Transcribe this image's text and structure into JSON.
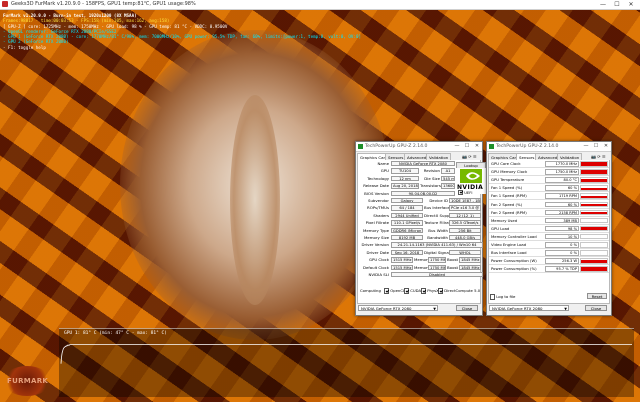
{
  "window": {
    "title": "Geeks3D FurMark v1.20.9.0 - 158FPS, GPU1 temp:81℃, GPU1 usage:98%",
    "controls": [
      "—",
      "☐",
      "✕"
    ]
  },
  "osd": {
    "line0": "FurMark v1.20.9.0 - Burn-in test, 1920x1200 (8X MSAA)",
    "line1": "Frames:98817 - time:00:03:53 - FPS:158 (min:105, max:162, avg:158)",
    "line2": "[ GPU-Z ] core: 1725MHz - mem: 1750MHz - GPU load: 98 % - GPU temp: 81 °C - VDDC: 0.9500V",
    "line3": "- OpenGL renderer: GeForce RTX 2080/PCIe/SSE2",
    "line4": "- GPU 1 (GeForce RTX 2080) - core: 1770MHz/81° C/98%, mem: 7000MHz/10%, GPU power: 95.5% TDP, fan: 60%, limits:[power:1, temp:0, volt:0, OV:0]",
    "line5": "- GPU 2 (GeForce RTX 2080)",
    "line6": "- F1: toggle help"
  },
  "graph": {
    "label": "GPU 1: 81° C (min: 47° C - max: 81° C)",
    "series": [
      47,
      58,
      66,
      70,
      73,
      75,
      76,
      77,
      78,
      78,
      79,
      79,
      80,
      80,
      80,
      80,
      81,
      81,
      81,
      81,
      81,
      81,
      81,
      81,
      81,
      81,
      81,
      81,
      81,
      81,
      81,
      81,
      81,
      81,
      81,
      81,
      81,
      81,
      81,
      81,
      81
    ],
    "ymin": 0,
    "ymax": 100
  },
  "logo": {
    "text": "FURMARK"
  },
  "gpuz_card": {
    "title": "TechPowerUp GPU-Z 2.14.0",
    "tabs": [
      "Graphics Card",
      "Sensors",
      "Advanced",
      "Validation"
    ],
    "lookup": "Lookup",
    "uefi": "UEFI",
    "rows": [
      {
        "label": "Name",
        "v1": "NVIDIA GeForce RTX 2080"
      },
      {
        "label": "GPU",
        "v1": "TU104",
        "l2": "Revision",
        "v2": "A1"
      },
      {
        "label": "Technology",
        "v1": "12 nm",
        "l2": "Die Size",
        "v2": "545 mm²"
      },
      {
        "label": "Release Date",
        "v1": "Aug 20, 2018",
        "l2": "Transistors",
        "v2": "13600M"
      },
      {
        "label": "BIOS Version",
        "v1": "90.04.0B.00.D2"
      },
      {
        "label": "Subvendor",
        "v1": "Galaxy",
        "l2": "Device ID",
        "v2": "10DE 1E87 - 1B4C 1302"
      },
      {
        "label": "ROPs/TMUs",
        "v1": "64 / 184",
        "l2": "Bus Interface",
        "v2": "PCIe x16 3.0 @ x16 3.0"
      },
      {
        "label": "Shaders",
        "v1": "2944 Unified",
        "l2": "DirectX Support",
        "v2": "12 (12_1)"
      },
      {
        "label": "Pixel Fillrate",
        "v1": "110.1 GPixel/s",
        "l2": "Texture Fillrate",
        "v2": "326.5 GTexel/s"
      },
      {
        "label": "Memory Type",
        "v1": "GDDR6 (Micron)",
        "l2": "Bus Width",
        "v2": "256 Bit"
      },
      {
        "label": "Memory Size",
        "v1": "8192 MB",
        "l2": "Bandwidth",
        "v2": "448.0 GB/s"
      },
      {
        "label": "Driver Version",
        "v1": "24.21.14.1163 (NVIDIA 411.63) / Win10 64"
      },
      {
        "label": "Driver Date",
        "v1": "Sep 16, 2018",
        "l2": "Digital Signature",
        "v2": "WHQL"
      },
      {
        "label": "GPU Clock",
        "v1": "1515 MHz",
        "l2": "Memory",
        "v2": "1750 MHz",
        "l3": "Boost",
        "v3": "1845 MHz"
      },
      {
        "label": "Default Clock",
        "v1": "1515 MHz",
        "l2": "Memory",
        "v2": "1750 MHz",
        "l3": "Boost",
        "v3": "1845 MHz"
      },
      {
        "label": "NVIDIA SLI",
        "v1": "Disabled"
      }
    ],
    "computing_label": "Computing",
    "computing": [
      "OpenCL",
      "CUDA",
      "PhysX",
      "DirectCompute 5.0"
    ],
    "selected_gpu": "NVIDIA GeForce RTX 2080",
    "close": "Close"
  },
  "gpuz_sensors": {
    "title": "TechPowerUp GPU-Z 2.14.0",
    "tabs": [
      "Graphics Card",
      "Sensors",
      "Advanced",
      "Validation"
    ],
    "rows": [
      {
        "label": "GPU Core Clock",
        "value": "1770.0 MHz",
        "level": 0.95
      },
      {
        "label": "GPU Memory Clock",
        "value": "1750.0 MHz",
        "level": 0.9
      },
      {
        "label": "GPU Temperature",
        "value": "80.0 °C",
        "level": 0.85
      },
      {
        "label": "Fan 1 Speed (%)",
        "value": "60 %",
        "level": 0.6
      },
      {
        "label": "Fan 1 Speed (RPM)",
        "value": "1719 RPM",
        "level": 0.6
      },
      {
        "label": "Fan 2 Speed (%)",
        "value": "60 %",
        "level": 0.6
      },
      {
        "label": "Fan 2 Speed (RPM)",
        "value": "2158 RPM",
        "level": 0.65
      },
      {
        "label": "Memory Used",
        "value": "389 MB",
        "level": 0.1
      },
      {
        "label": "GPU Load",
        "value": "98 %",
        "level": 0.98
      },
      {
        "label": "Memory Controller Load",
        "value": "10 %",
        "level": 0.1
      },
      {
        "label": "Video Engine Load",
        "value": "0 %",
        "level": 0
      },
      {
        "label": "Bus Interface Load",
        "value": "0 %",
        "level": 0.02
      },
      {
        "label": "Power Consumption (W)",
        "value": "256.3 W",
        "level": 0.9
      },
      {
        "label": "Power Consumption (%)",
        "value": "95.7 % TDP",
        "level": 0.95
      }
    ],
    "log_label": "Log to file",
    "reset": "Reset",
    "selected_gpu": "NVIDIA GeForce RTX 2080",
    "close": "Close"
  },
  "colors": {
    "sensor_bar": "#dd0000",
    "osd_yellow": "#ffe23a",
    "osd_cyan": "#00e8ff"
  }
}
